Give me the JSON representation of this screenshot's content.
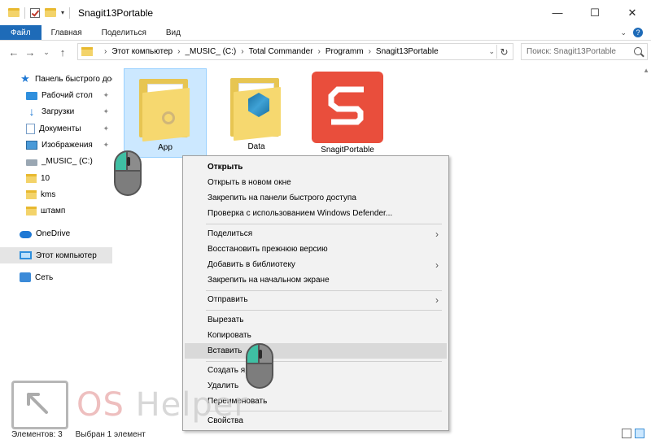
{
  "window": {
    "title": "Snagit13Portable",
    "minimize": "—",
    "maximize": "☐",
    "close": "✕"
  },
  "ribbon": {
    "tabs": [
      "Файл",
      "Главная",
      "Поделиться",
      "Вид"
    ]
  },
  "address": {
    "crumbs": [
      "Этот компьютер",
      "_MUSIC_ (C:)",
      "Total Commander",
      "Programm",
      "Snagit13Portable"
    ],
    "search_placeholder": "Поиск: Snagit13Portable"
  },
  "sidebar": {
    "items": [
      {
        "label": "Панель быстрого доступа",
        "icon": "star-icon"
      },
      {
        "label": "Рабочий стол",
        "icon": "desktop-icon",
        "pinned": true
      },
      {
        "label": "Загрузки",
        "icon": "download-icon",
        "pinned": true
      },
      {
        "label": "Документы",
        "icon": "documents-icon",
        "pinned": true
      },
      {
        "label": "Изображения",
        "icon": "pictures-icon",
        "pinned": true
      },
      {
        "label": "_MUSIC_ (C:)",
        "icon": "drive-icon"
      },
      {
        "label": "10",
        "icon": "folder-icon"
      },
      {
        "label": "kms",
        "icon": "folder-icon"
      },
      {
        "label": "штамп",
        "icon": "folder-icon"
      },
      {
        "label": "OneDrive",
        "icon": "cloud-icon"
      },
      {
        "label": "Этот компьютер",
        "icon": "computer-icon",
        "selected": true
      },
      {
        "label": "Сеть",
        "icon": "network-icon"
      }
    ]
  },
  "files": [
    {
      "label": "App",
      "type": "folder",
      "selected": true
    },
    {
      "label": "Data",
      "type": "folder-cube"
    },
    {
      "label": "SnagitPortable",
      "type": "snagit-app"
    }
  ],
  "context_menu": {
    "groups": [
      [
        "Открыть",
        "Открыть в новом окне",
        "Закрепить на панели быстрого доступа",
        "Проверка с использованием Windows Defender..."
      ],
      [
        "Поделиться",
        "Восстановить прежнюю версию",
        "Добавить в библиотеку",
        "Закрепить на начальном экране"
      ],
      [
        "Отправить"
      ],
      [
        "Вырезать",
        "Копировать",
        "Вставить"
      ],
      [
        "Создать ярлык",
        "Удалить",
        "Переименовать"
      ],
      [
        "Свойства"
      ]
    ],
    "highlighted": "Вставить"
  },
  "watermark": {
    "text_a": "OS",
    "text_b": " Helper"
  },
  "status": {
    "count": "Элементов: 3",
    "selected": "Выбран 1 элемент"
  }
}
